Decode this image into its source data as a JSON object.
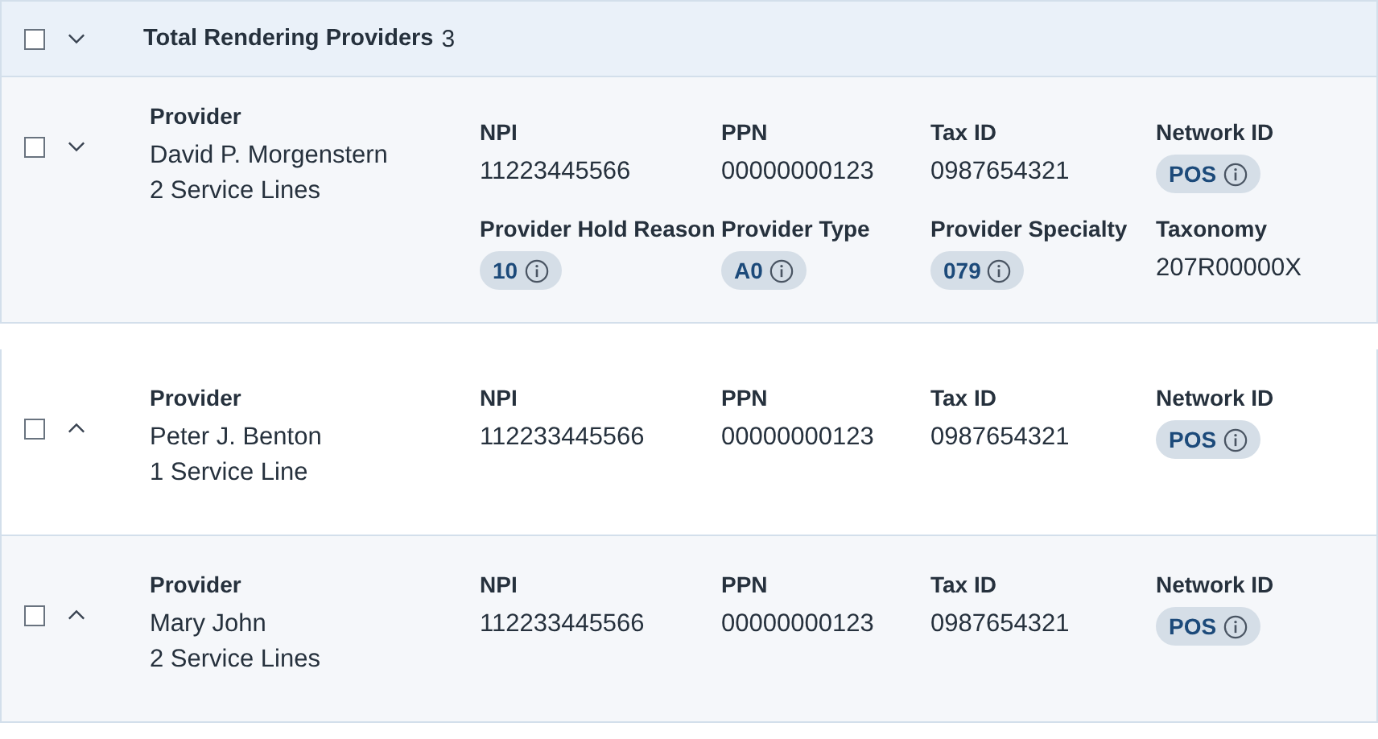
{
  "header": {
    "checked": false,
    "expanded": true,
    "title": "Total Rendering Providers",
    "count": "3"
  },
  "providers": [
    {
      "checked": false,
      "expanded": true,
      "label": "Provider",
      "name": "David P. Morgenstern",
      "service_lines": "2 Service Lines",
      "fields": [
        {
          "label": "NPI",
          "value": "11223445566",
          "kind": "text"
        },
        {
          "label": "PPN",
          "value": "00000000123",
          "kind": "text"
        },
        {
          "label": "Tax ID",
          "value": "0987654321",
          "kind": "text"
        },
        {
          "label": "Network ID",
          "value": "POS",
          "kind": "badge"
        },
        {
          "label": "Provider Hold Reason",
          "value": "10",
          "kind": "badge"
        },
        {
          "label": "Provider Type",
          "value": "A0",
          "kind": "badge"
        },
        {
          "label": "Provider Specialty",
          "value": "079",
          "kind": "badge"
        },
        {
          "label": "Taxonomy",
          "value": "207R00000X",
          "kind": "text"
        }
      ]
    },
    {
      "checked": false,
      "expanded": false,
      "label": "Provider",
      "name": "Peter J. Benton",
      "service_lines": "1 Service Line",
      "fields": [
        {
          "label": "NPI",
          "value": "112233445566",
          "kind": "text"
        },
        {
          "label": "PPN",
          "value": "00000000123",
          "kind": "text"
        },
        {
          "label": "Tax ID",
          "value": "0987654321",
          "kind": "text"
        },
        {
          "label": "Network ID",
          "value": "POS",
          "kind": "badge"
        }
      ]
    },
    {
      "checked": false,
      "expanded": false,
      "label": "Provider",
      "name": "Mary John",
      "service_lines": "2 Service Lines",
      "fields": [
        {
          "label": "NPI",
          "value": "112233445566",
          "kind": "text"
        },
        {
          "label": "PPN",
          "value": "00000000123",
          "kind": "text"
        },
        {
          "label": "Tax ID",
          "value": "0987654321",
          "kind": "text"
        },
        {
          "label": "Network ID",
          "value": "POS",
          "kind": "badge"
        }
      ]
    }
  ]
}
